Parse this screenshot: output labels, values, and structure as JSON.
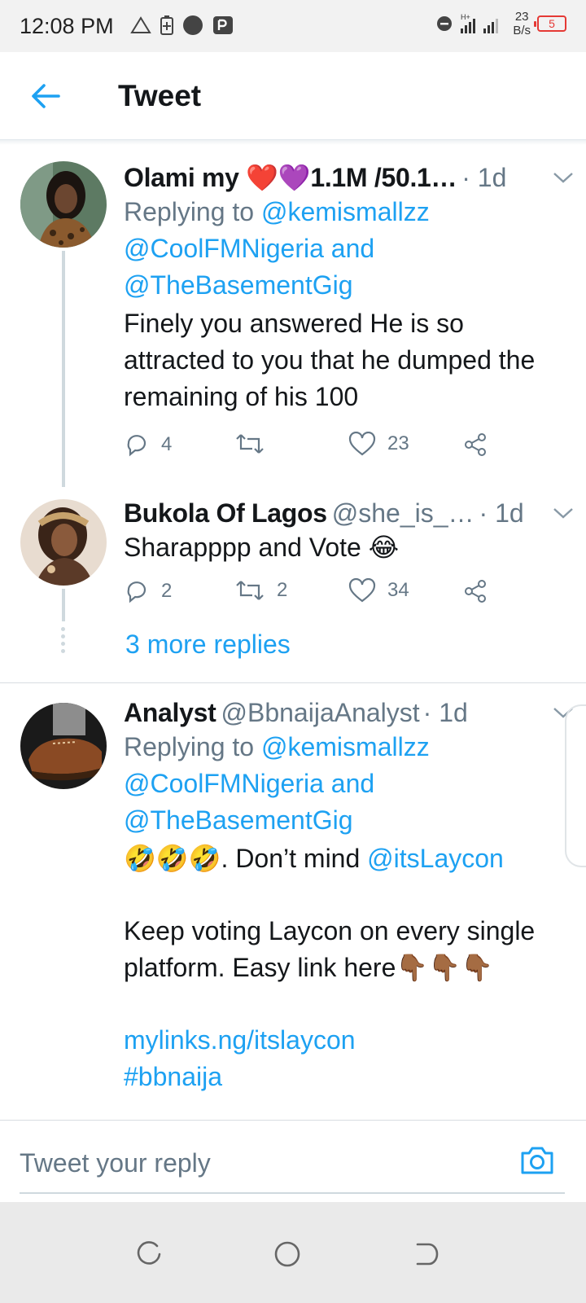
{
  "status_bar": {
    "time": "12:08 PM",
    "net_speed_value": "23",
    "net_speed_unit": "B/s",
    "battery": "5",
    "network_type": "H+"
  },
  "header": {
    "title": "Tweet"
  },
  "tweets": [
    {
      "name": "Olami my ❤️💜1.1M /50.1…",
      "handle": "",
      "time": "· 1d",
      "replying_prefix": "Replying to",
      "replying_to_1": "@kemismallzz",
      "replying_to_2": "@CoolFMNigeria",
      "replying_and": "and",
      "replying_to_3": "@TheBasementGig",
      "text": "Finely you answered He is so attracted to you that he dumped the remaining of his 100",
      "replies": "4",
      "retweets": "",
      "likes": "23"
    },
    {
      "name": "Bukola Of Lagos",
      "handle": "@she_is_…",
      "time": "· 1d",
      "text": "Sharapppp and Vote 😂",
      "replies": "2",
      "retweets": "2",
      "likes": "34"
    },
    {
      "name": "Analyst",
      "handle": "@BbnaijaAnalyst",
      "time": "· 1d",
      "replying_prefix": "Replying to",
      "replying_to_1": "@kemismallzz",
      "replying_to_2": "@CoolFMNigeria",
      "replying_and": "and",
      "replying_to_3": "@TheBasementGig",
      "text_line1_emoji": "🤣🤣🤣",
      "text_line1": ". Don’t mind",
      "mention": "@itsLaycon",
      "text_line2": "Keep voting Laycon on every single platform. Easy link here👇🏾👇🏾👇🏾",
      "link": "mylinks.ng/itslaycon",
      "hashtag": "#bbnaija"
    }
  ],
  "more_replies": "3 more replies",
  "reply_bar": {
    "placeholder": "Tweet your reply"
  },
  "colors": {
    "accent": "#1da1f2",
    "secondary_text": "#657786",
    "primary_text": "#14171a"
  },
  "icons": [
    "back-arrow-icon",
    "chevron-down-icon",
    "reply-icon",
    "retweet-icon",
    "like-icon",
    "share-icon",
    "camera-icon",
    "recent-apps-icon",
    "home-icon",
    "back-nav-icon"
  ]
}
